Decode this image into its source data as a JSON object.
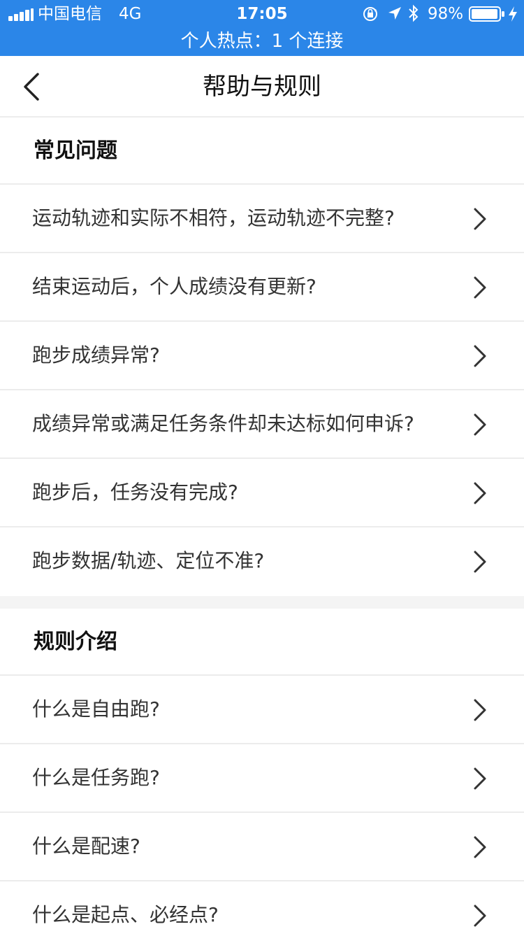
{
  "status_bar": {
    "carrier": "中国电信",
    "network": "4G",
    "time": "17:05",
    "battery_percent": "98%",
    "hotspot_text": "个人热点：1 个连接",
    "color": "#2b86e8"
  },
  "nav": {
    "title": "帮助与规则"
  },
  "faq": {
    "title": "常见问题",
    "items": [
      {
        "label": "运动轨迹和实际不相符，运动轨迹不完整?"
      },
      {
        "label": "结束运动后，个人成绩没有更新?"
      },
      {
        "label": "跑步成绩异常?"
      },
      {
        "label": "成绩异常或满足任务条件却未达标如何申诉?"
      },
      {
        "label": "跑步后，任务没有完成?"
      },
      {
        "label": "跑步数据/轨迹、定位不准?"
      }
    ]
  },
  "rules": {
    "title": "规则介绍",
    "items": [
      {
        "label": "什么是自由跑?"
      },
      {
        "label": "什么是任务跑?"
      },
      {
        "label": "什么是配速?"
      },
      {
        "label": "什么是起点、必经点?"
      }
    ]
  }
}
